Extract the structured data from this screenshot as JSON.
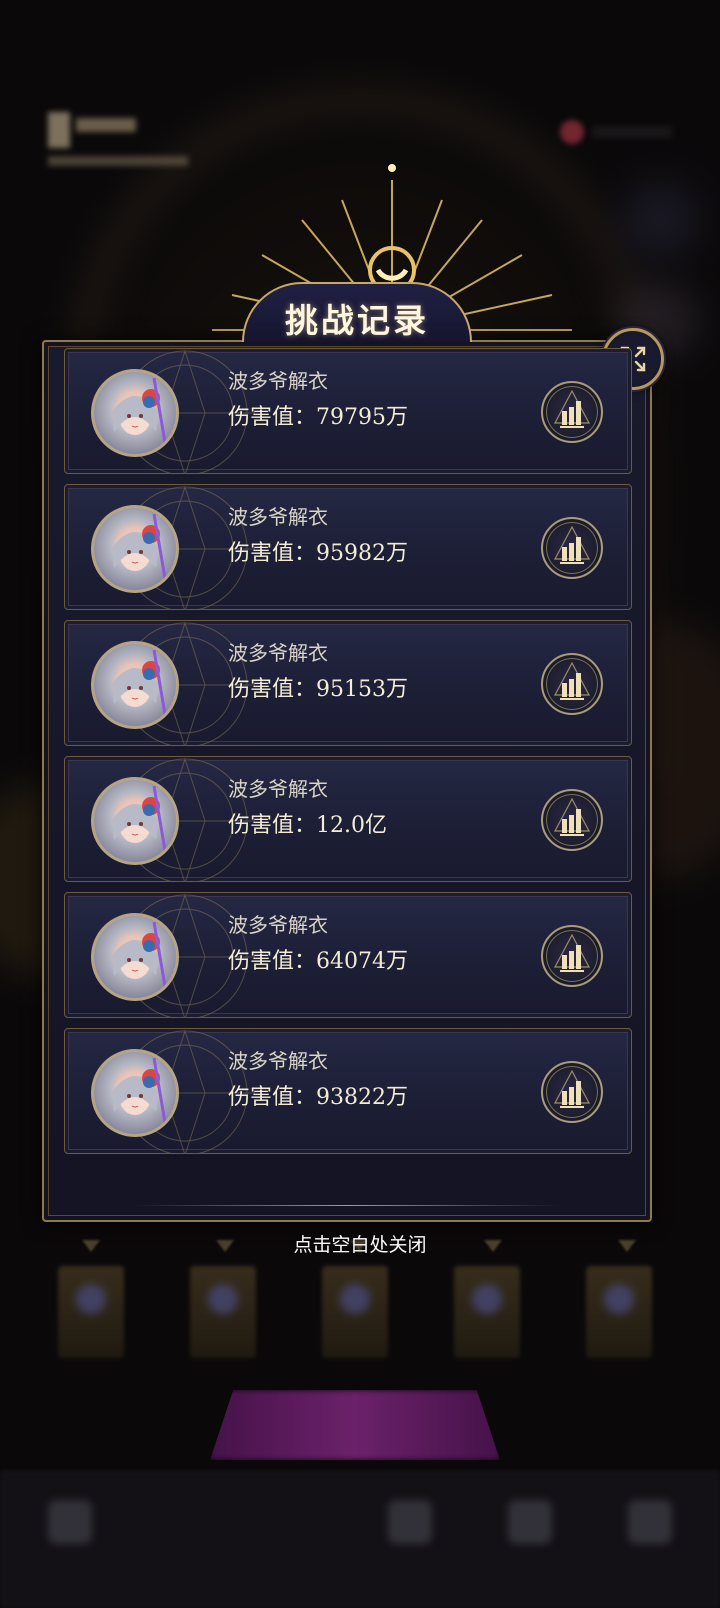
{
  "dialog": {
    "title": "挑战记录",
    "close_hint": "点击空白处关闭",
    "records": [
      {
        "name": "波多爷解衣",
        "damage": "伤害值：79795万"
      },
      {
        "name": "波多爷解衣",
        "damage": "伤害值：95982万"
      },
      {
        "name": "波多爷解衣",
        "damage": "伤害值：95153万"
      },
      {
        "name": "波多爷解衣",
        "damage": "伤害值：12.0亿"
      },
      {
        "name": "波多爷解衣",
        "damage": "伤害值：64074万"
      },
      {
        "name": "波多爷解衣",
        "damage": "伤害值：93822万"
      }
    ]
  },
  "icons": {
    "close": "expand-arrows-icon",
    "stats": "bar-chart-icon",
    "avatar_overlay": "Bring ting St"
  },
  "colors": {
    "gold": "#c8a867",
    "panel": "#1c1e35",
    "text": "#f5ecd6"
  }
}
